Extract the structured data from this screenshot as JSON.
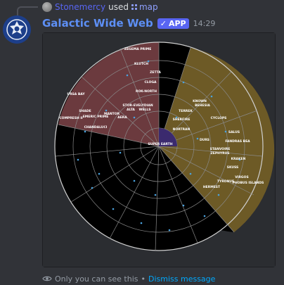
{
  "reply": {
    "user": "Stonemercy",
    "verb": "used",
    "command": "map"
  },
  "message": {
    "bot_name": "Galactic Wide Web",
    "badge": "APP",
    "time": "14:29"
  },
  "map": {
    "center_label": "SUPER EARTH",
    "sectors": [
      {
        "name": "top-left",
        "color": "#6b3a3e"
      },
      {
        "name": "right",
        "color": "#6d5a26"
      },
      {
        "name": "neutral",
        "color": "#000000"
      }
    ],
    "planet_labels": [
      "ZEGEMA PRIME",
      "KLUTCH",
      "ZETTA",
      "CLOGA",
      "ROK-NORTH",
      "URSA BAY",
      "COMPRESH II",
      "MANTOR",
      "EMERIC PRIME",
      "AERA",
      "ALTA",
      "CHANDALUCI",
      "STOR-EVELYDIAN",
      "WELLS",
      "TERREK",
      "SHERFIRE",
      "NORTRAN",
      "KNOWN",
      "BEHESIA",
      "CYCLOPS",
      "SALUS",
      "FANDRAS BEA",
      "DURS",
      "STANVOIRE",
      "ZEPHYRUS",
      "KRAKEN",
      "SKUSS",
      "VIRGOS",
      "TYRONUS",
      "HERMEST",
      "PHOBUS ISLANDS",
      "SHADE"
    ]
  },
  "footer": {
    "notice": "Only you can see this",
    "separator": "•",
    "dismiss": "Dismiss message"
  }
}
